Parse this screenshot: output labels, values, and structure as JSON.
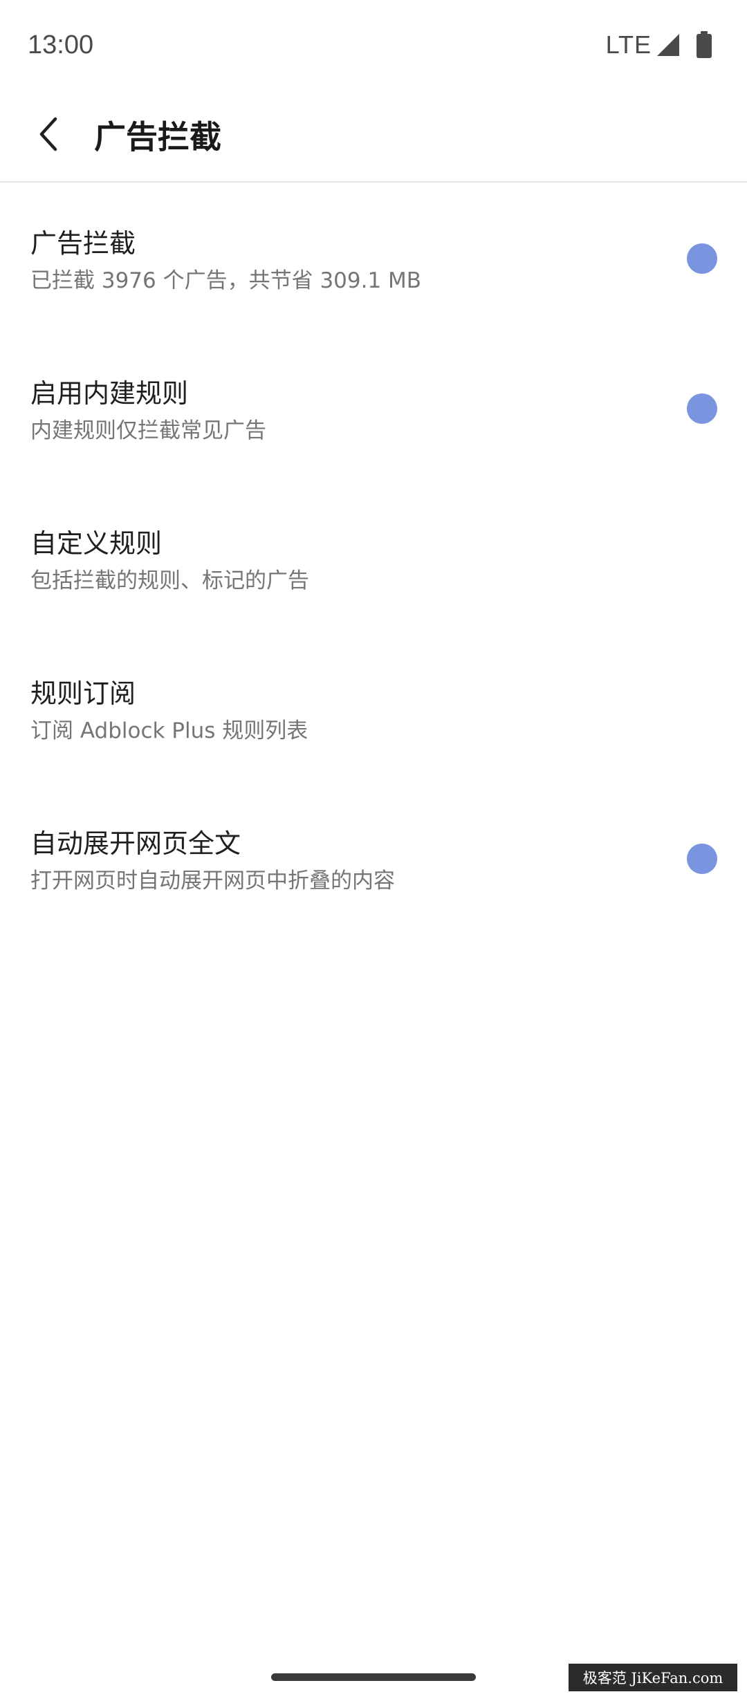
{
  "status_bar": {
    "time": "13:00",
    "network": "LTE",
    "signal_icon": "cell-signal-icon",
    "battery_icon": "battery-icon"
  },
  "app_bar": {
    "back_icon": "chevron-left-icon",
    "title": "广告拦截"
  },
  "colors": {
    "accent": "#7a95e0",
    "title_text": "#1f1f1f",
    "subtitle_text": "#757575",
    "divider": "#e3e3e3"
  },
  "settings": [
    {
      "title": "广告拦截",
      "subtitle": "已拦截 3976 个广告，共节省 309.1 MB",
      "has_toggle": true,
      "toggle_on": true
    },
    {
      "title": "启用内建规则",
      "subtitle": "内建规则仅拦截常见广告",
      "has_toggle": true,
      "toggle_on": true
    },
    {
      "title": "自定义规则",
      "subtitle": "包括拦截的规则、标记的广告",
      "has_toggle": false
    },
    {
      "title": "规则订阅",
      "subtitle": "订阅 Adblock Plus 规则列表",
      "has_toggle": false
    },
    {
      "title": "自动展开网页全文",
      "subtitle": "打开网页时自动展开网页中折叠的内容",
      "has_toggle": true,
      "toggle_on": true
    }
  ],
  "watermark": "极客范 JiKeFan.com"
}
